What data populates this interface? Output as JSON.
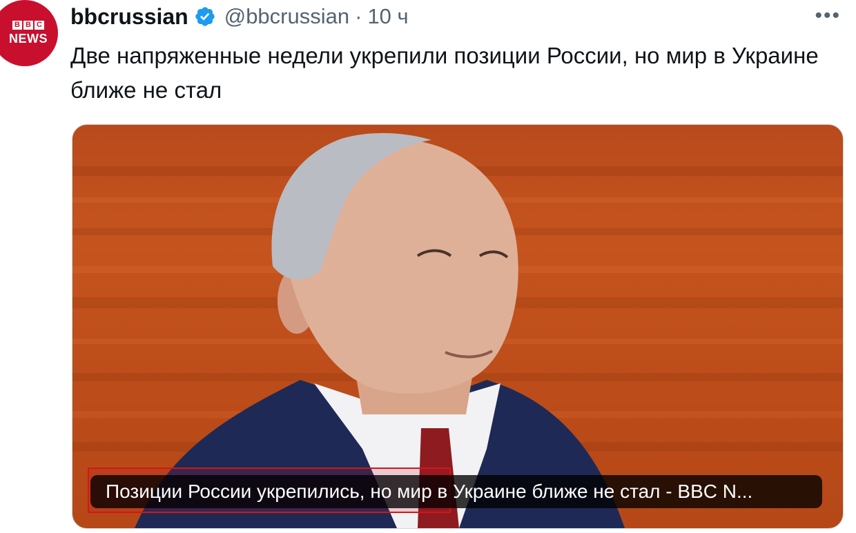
{
  "account": {
    "avatar_line1": "BBC",
    "avatar_line2": "NEWS",
    "name": "bbcrussian",
    "handle": "@bbcrussian",
    "separator": "·",
    "time": "10 ч",
    "more": "•••"
  },
  "tweet": {
    "text": "Две напряженные недели укрепили позиции России, но мир в Украине ближе не стал"
  },
  "card": {
    "caption": "Позиции России укрепились, но мир в Украине ближе не стал - BBC N..."
  },
  "icons": {
    "verified": "verified-badge-icon",
    "more": "more-icon"
  },
  "colors": {
    "verified": "#1d9bf0",
    "bbc_red": "#c8102e",
    "card_bg": "#c5541e"
  }
}
